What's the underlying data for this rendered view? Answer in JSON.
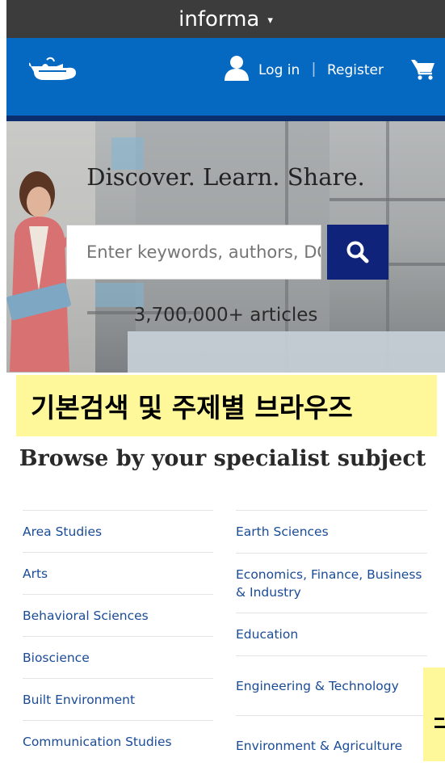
{
  "top_bar": {
    "brand": "informa",
    "caret": "▾"
  },
  "header": {
    "logo_icon": "lamp-logo-icon",
    "login": "Log in",
    "separator": "|",
    "register": "Register",
    "cart_icon": "cart-icon"
  },
  "hero": {
    "tagline": "Discover. Learn. Share.",
    "search_placeholder": "Enter keywords, authors, DOI, ORCID etc",
    "search_icon": "search-icon",
    "articles": "3,700,000+ articles"
  },
  "annotation": {
    "label": "기본검색 및 주제별 브라우즈"
  },
  "browse": {
    "title": "Browse by your specialist subject",
    "left": [
      "Area Studies",
      "Arts",
      "Behavioral Sciences",
      "Bioscience",
      "Built Environment",
      "Communication Studies"
    ],
    "right": [
      "Earth Sciences",
      "Economics, Finance, Business & Industry",
      "Education",
      "Engineering & Technology",
      "Environment & Agriculture"
    ]
  },
  "colors": {
    "header_blue": "#0569c1",
    "header_border": "#0b2e6f",
    "search_button": "#10237a",
    "annotation_yellow": "#fff89a",
    "link": "#1a4b97"
  }
}
